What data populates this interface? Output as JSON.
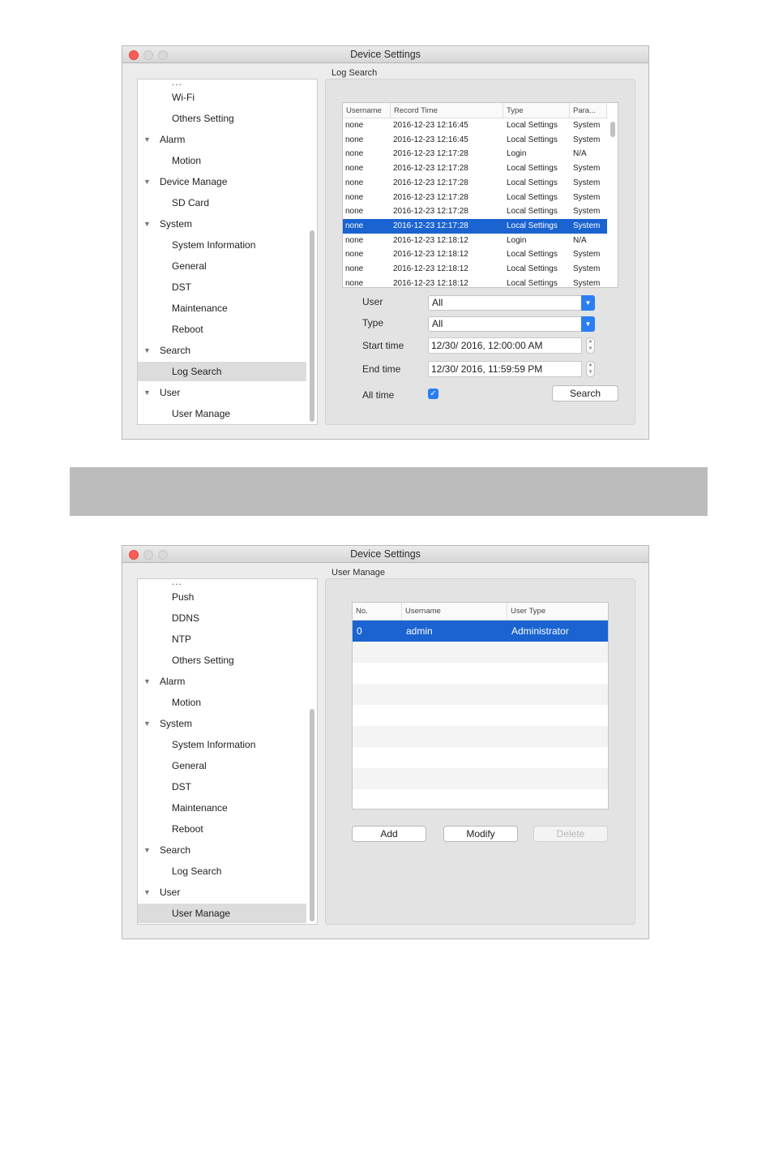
{
  "window1": {
    "title": "Device Settings",
    "sidebar_cut_text": "...",
    "sidebar": [
      {
        "label": "Wi-Fi",
        "level": 1
      },
      {
        "label": "Others Setting",
        "level": 1
      },
      {
        "label": "Alarm",
        "level": 0
      },
      {
        "label": "Motion",
        "level": 1
      },
      {
        "label": "Device Manage",
        "level": 0
      },
      {
        "label": "SD Card",
        "level": 1
      },
      {
        "label": "System",
        "level": 0
      },
      {
        "label": "System Information",
        "level": 1
      },
      {
        "label": "General",
        "level": 1
      },
      {
        "label": "DST",
        "level": 1
      },
      {
        "label": "Maintenance",
        "level": 1
      },
      {
        "label": "Reboot",
        "level": 1
      },
      {
        "label": "Search",
        "level": 0
      },
      {
        "label": "Log Search",
        "level": 1,
        "selected": true
      },
      {
        "label": "User",
        "level": 0
      },
      {
        "label": "User Manage",
        "level": 1
      }
    ],
    "panel_label": "Log Search",
    "table": {
      "columns": [
        "Username",
        "Record Time",
        "Type",
        "Para..."
      ],
      "rows": [
        [
          "none",
          "2016-12-23 12:16:45",
          "Local Settings",
          "System"
        ],
        [
          "none",
          "2016-12-23 12:16:45",
          "Local Settings",
          "System"
        ],
        [
          "none",
          "2016-12-23 12:17:28",
          "Login",
          "N/A"
        ],
        [
          "none",
          "2016-12-23 12:17:28",
          "Local Settings",
          "System"
        ],
        [
          "none",
          "2016-12-23 12:17:28",
          "Local Settings",
          "System"
        ],
        [
          "none",
          "2016-12-23 12:17:28",
          "Local Settings",
          "System"
        ],
        [
          "none",
          "2016-12-23 12:17:28",
          "Local Settings",
          "System"
        ],
        [
          "none",
          "2016-12-23 12:17:28",
          "Local Settings",
          "System"
        ],
        [
          "none",
          "2016-12-23 12:18:12",
          "Login",
          "N/A"
        ],
        [
          "none",
          "2016-12-23 12:18:12",
          "Local Settings",
          "System"
        ],
        [
          "none",
          "2016-12-23 12:18:12",
          "Local Settings",
          "System"
        ],
        [
          "none",
          "2016-12-23 12:18:12",
          "Local Settings",
          "System"
        ]
      ],
      "selected_row": 7
    },
    "form": {
      "user_label": "User",
      "user_value": "All",
      "type_label": "Type",
      "type_value": "All",
      "start_label": "Start time",
      "start_value": "12/30/ 2016, 12:00:00 AM",
      "end_label": "End time",
      "end_value": "12/30/ 2016, 11:59:59 PM",
      "alltime_label": "All time",
      "alltime_checked": true,
      "search_button": "Search"
    }
  },
  "window2": {
    "title": "Device Settings",
    "sidebar_cut_text": "...",
    "sidebar": [
      {
        "label": "Push",
        "level": 1
      },
      {
        "label": "DDNS",
        "level": 1
      },
      {
        "label": "NTP",
        "level": 1
      },
      {
        "label": "Others Setting",
        "level": 1
      },
      {
        "label": "Alarm",
        "level": 0
      },
      {
        "label": "Motion",
        "level": 1
      },
      {
        "label": "System",
        "level": 0
      },
      {
        "label": "System Information",
        "level": 1
      },
      {
        "label": "General",
        "level": 1
      },
      {
        "label": "DST",
        "level": 1
      },
      {
        "label": "Maintenance",
        "level": 1
      },
      {
        "label": "Reboot",
        "level": 1
      },
      {
        "label": "Search",
        "level": 0
      },
      {
        "label": "Log Search",
        "level": 1
      },
      {
        "label": "User",
        "level": 0
      },
      {
        "label": "User Manage",
        "level": 1,
        "selected": true
      }
    ],
    "panel_label": "User Manage",
    "table": {
      "columns": [
        "No.",
        "Username",
        "User Type"
      ],
      "rows": [
        [
          "0",
          "admin",
          "Administrator"
        ]
      ]
    },
    "buttons": {
      "add": "Add",
      "modify": "Modify",
      "delete": "Delete"
    }
  },
  "colors": {
    "selection": "#1a63d1",
    "accent_blue": "#2a7ef2",
    "close_red": "#fc5d57",
    "window_bg": "#ececec",
    "separator_band": "#bcbcbc"
  },
  "icons": [
    "close-icon",
    "minimize-icon",
    "zoom-icon",
    "disclosure-triangle-icon",
    "chevron-updown-icon",
    "checkmark-icon"
  ]
}
